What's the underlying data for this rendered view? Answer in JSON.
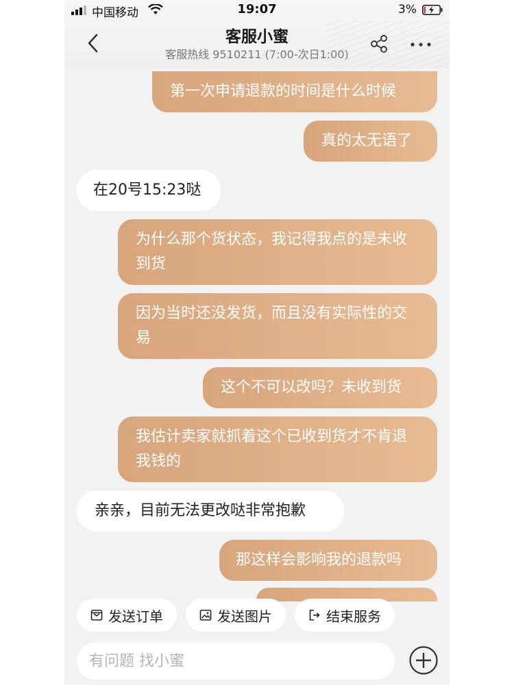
{
  "status_bar": {
    "carrier": "中国移动",
    "time": "19:07",
    "battery": "3%"
  },
  "header": {
    "title": "客服小蜜",
    "subtitle": "客服热线 9510211 (7:00-次日1:00)",
    "back_icon": "chevron-left-icon",
    "share_icon": "share-icon",
    "more_icon": "more-dots-icon"
  },
  "messages": [
    {
      "side": "out",
      "text": "第一次申请退款的时间是什么时候"
    },
    {
      "side": "out",
      "text": "真的太无语了"
    },
    {
      "side": "in",
      "text": "在20号15:23哒"
    },
    {
      "side": "out",
      "text": "为什么那个货状态，我记得我点的是未收到货"
    },
    {
      "side": "out",
      "text": "因为当时还没发货，而且没有实际性的交易"
    },
    {
      "side": "out",
      "text": "这个不可以改吗？未收到货"
    },
    {
      "side": "out",
      "text": "我估计卖家就抓着这个已收到货才不肯退我钱的"
    },
    {
      "side": "in",
      "text": "亲亲，目前无法更改哒非常抱歉"
    },
    {
      "side": "out",
      "text": "那这样会影响我的退款吗"
    }
  ],
  "quick_actions": [
    {
      "label": "发送订单",
      "icon": "order-icon"
    },
    {
      "label": "发送图片",
      "icon": "image-icon"
    },
    {
      "label": "结束服务",
      "icon": "exit-icon"
    }
  ],
  "input": {
    "placeholder": "有问题 找小蜜",
    "value": ""
  },
  "colors": {
    "outgoing_bubble_start": "#d8a57c",
    "outgoing_bubble_end": "#e7bb93",
    "incoming_bubble": "#ffffff",
    "background": "#f2f2f2"
  }
}
